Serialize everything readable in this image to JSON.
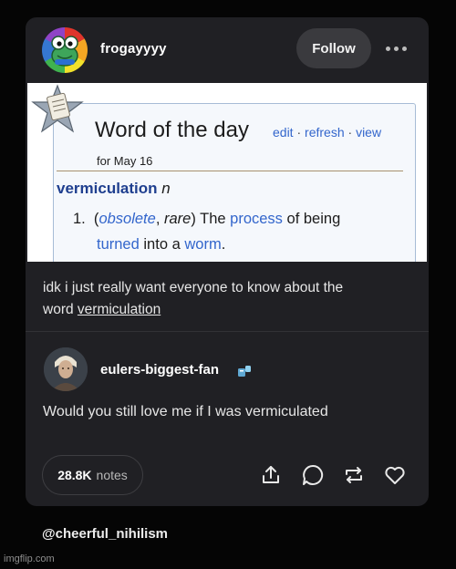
{
  "post": {
    "author": "frogayyyy",
    "follow_label": "Follow",
    "image": {
      "title": "Word of the day",
      "actions": [
        "edit",
        "refresh",
        "view"
      ],
      "date": "for May 16",
      "word": "vermiculation",
      "part_of_speech": "n",
      "number": "1.",
      "tag_1": "obsolete",
      "tag_2": "rare",
      "def_the": "The",
      "def_process": "process",
      "def_of_being": "of being",
      "def_turned": "turned",
      "def_into_a": "into a",
      "def_worm": "worm",
      "def_period": "."
    },
    "text_line_1": "idk i just really want everyone to know about the",
    "text_line_2_prefix": "word ",
    "text_line_2_link": "vermiculation"
  },
  "reply": {
    "author": "eulers-biggest-fan",
    "text": "Would you still love me if I was vermiculated"
  },
  "footer": {
    "notes_count": "28.8K",
    "notes_label": "notes",
    "actions": [
      "share-icon",
      "reply-icon",
      "reblog-icon",
      "like-icon"
    ]
  },
  "credit": "@cheerful_nihilism",
  "watermark": "imgflip.com"
}
